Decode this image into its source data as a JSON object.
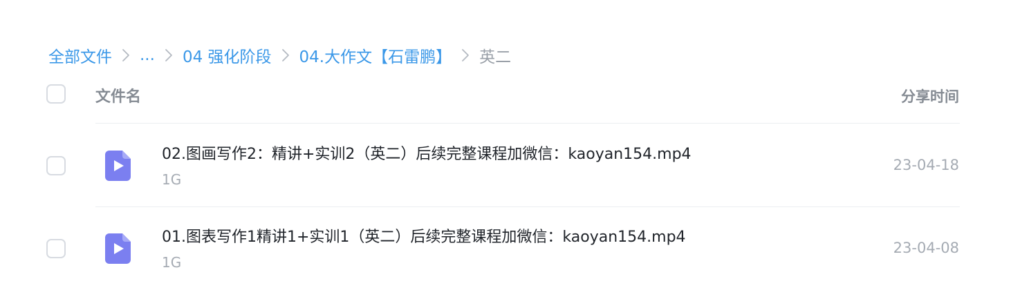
{
  "breadcrumb": {
    "items": [
      "全部文件",
      "...",
      "04 强化阶段",
      "04.大作文【石雷鹏】"
    ],
    "current": "英二"
  },
  "table": {
    "header_name": "文件名",
    "header_time": "分享时间"
  },
  "files": [
    {
      "name": "02.图画写作2：精讲+实训2（英二）后续完整课程加微信：kaoyan154.mp4",
      "size": "1G",
      "date": "23-04-18",
      "icon": "video-file-icon"
    },
    {
      "name": "01.图表写作1精讲1+实训1（英二）后续完整课程加微信：kaoyan154.mp4",
      "size": "1G",
      "date": "23-04-08",
      "icon": "video-file-icon"
    }
  ],
  "colors": {
    "link": "#3b98e8",
    "icon": "#7b7ff0"
  }
}
